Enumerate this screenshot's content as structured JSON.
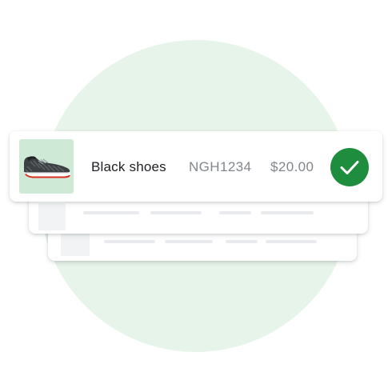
{
  "product": {
    "name": "Black shoes",
    "sku": "NGH1234",
    "price": "$20.00",
    "status": "verified"
  },
  "icons": {
    "check": "check-icon",
    "shoe": "shoe-image"
  },
  "colors": {
    "background_circle": "#e6f4ea",
    "thumbnail_bg": "#ceead6",
    "check_bg": "#1e8e3e",
    "name_text": "#202124",
    "secondary_text": "#80868b",
    "placeholder": "#e8eaed"
  }
}
